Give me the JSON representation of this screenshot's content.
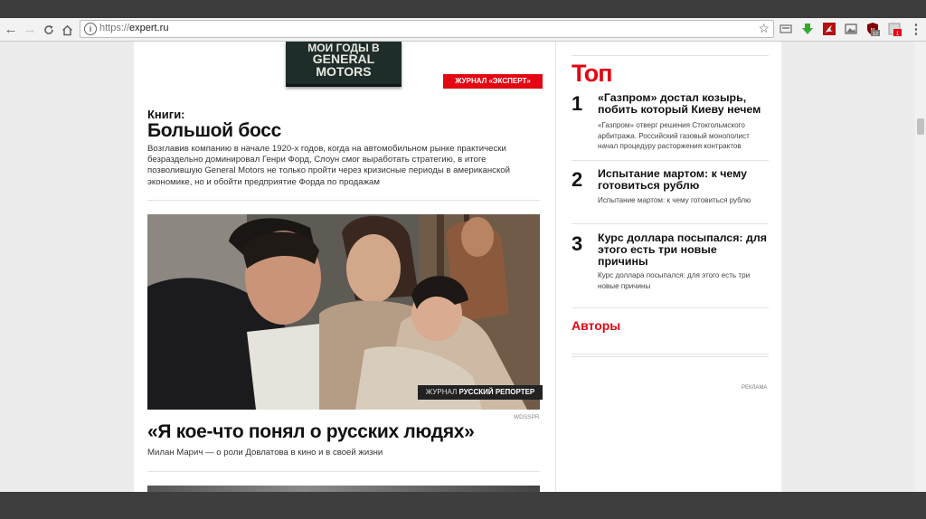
{
  "browser": {
    "url_protocol": "https://",
    "url_domain": "expert.ru",
    "info_glyph": "i",
    "star_glyph": "☆",
    "menu_glyph": "⋮",
    "ext_badge_count_1": "12",
    "ext_badge_count_2": "1"
  },
  "banner": {
    "line1": "МОИ ГОДЫ В",
    "line2": "GENERAL",
    "line3": "MOTORS",
    "journal_prefix": "ЖУРНАЛ ",
    "journal_name": "«ЭКСПЕРТ»"
  },
  "books": {
    "kicker": "Книги:",
    "title": "Большой босс",
    "description": "Возглавив компанию в начале 1920-х годов, когда на автомобильном рынке практически безраздельно доминировал Генри Форд, Слоун смог выработать стратегию, в итоге позволившую General Motors не только пройти через кризисные периоды в американской экономике, но и обойти предприятие Форда по продажам"
  },
  "feature": {
    "badge_prefix": "ЖУРНАЛ ",
    "badge_name": "РУССКИЙ РЕПОРТЕР",
    "credit": "WDSSPR",
    "title": "«Я кое-что понял о русских людях»",
    "subtitle": "Милан Марич — о роли Довлатова в кино и в своей жизни"
  },
  "sidebar": {
    "top_heading": "Топ",
    "items": [
      {
        "num": "1",
        "title": "«Газпром» достал козырь, побить который Киеву нечем",
        "desc": "«Газпром» отверг решения Стокгольмского арбитража. Российский газовый монополист начал процедуру расторжения контрактов"
      },
      {
        "num": "2",
        "title": "Испытание мартом: к чему готовиться рублю",
        "desc": "Испытание мартом: к чему готовиться рублю"
      },
      {
        "num": "3",
        "title": "Курс доллара посыпался: для этого есть три новые причины",
        "desc": "Курс доллара посыпался: для этого есть три новые причины"
      }
    ],
    "authors_heading": "Авторы",
    "ad_label": "РЕКЛАМА"
  },
  "colors": {
    "accent_red": "#e30613",
    "text_dark": "#111111"
  }
}
